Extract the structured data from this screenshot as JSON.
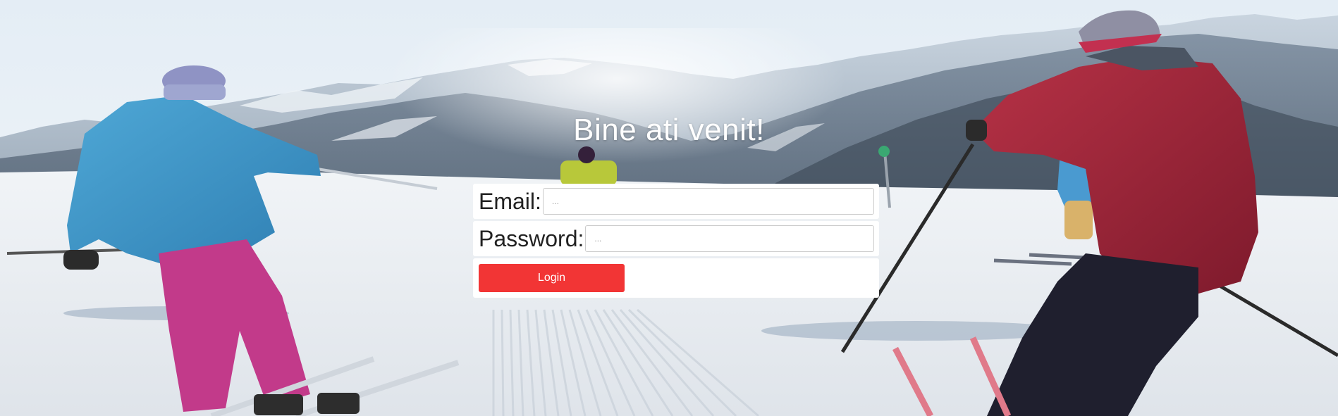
{
  "page": {
    "heading": "Bine ati venit!"
  },
  "form": {
    "email_label": "Email:",
    "email_placeholder": "...",
    "email_value": "",
    "password_label": "Password:",
    "password_placeholder": "...",
    "password_value": "",
    "login_label": "Login"
  },
  "colors": {
    "login_button": "#f23535",
    "panel": "#ffffff",
    "heading_text": "#ffffff"
  }
}
